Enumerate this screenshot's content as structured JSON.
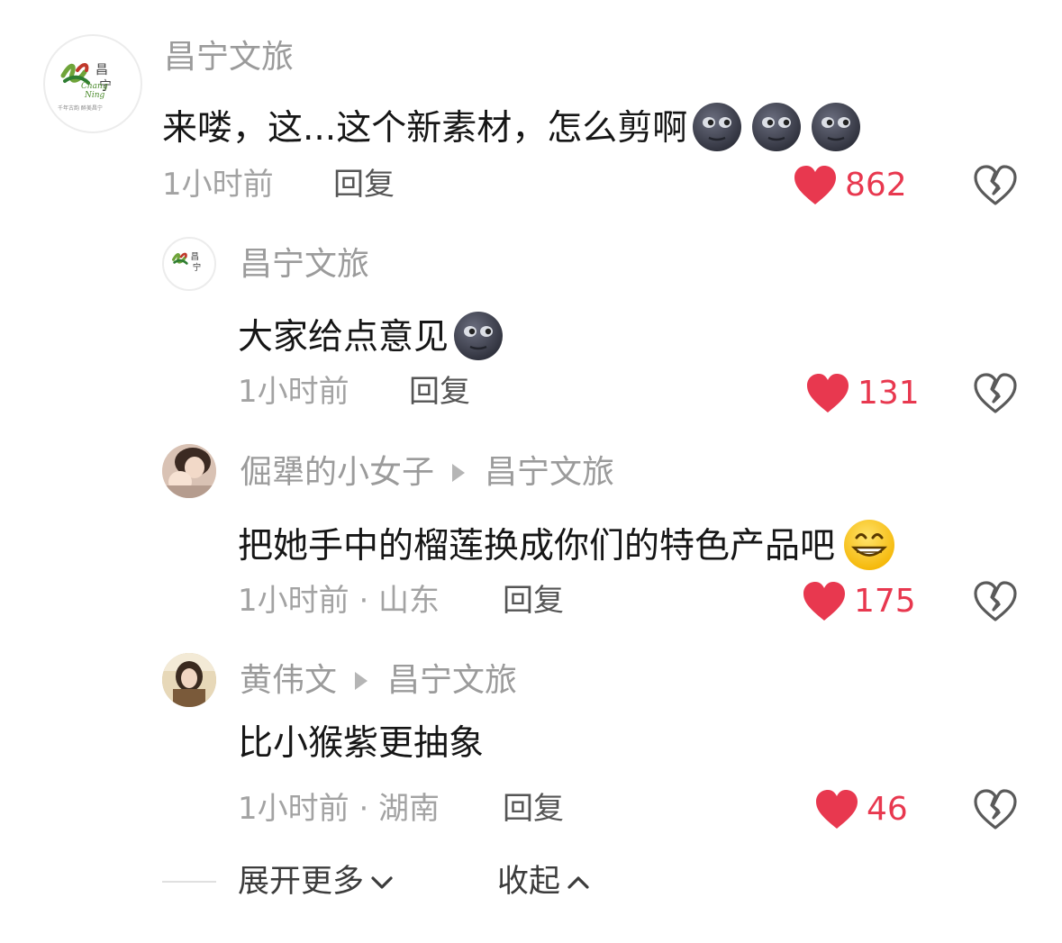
{
  "comments": [
    {
      "author": "昌宁文旅",
      "text": "来喽，这...这个新素材，怎么剪啊",
      "emojis": [
        "new-moon-face-emoji",
        "new-moon-face-emoji",
        "new-moon-face-emoji"
      ],
      "time": "1小时前",
      "reply_label": "回复",
      "likes": "862"
    },
    {
      "author": "昌宁文旅",
      "text": "大家给点意见",
      "emojis": [
        "new-moon-face-emoji"
      ],
      "time": "1小时前",
      "reply_label": "回复",
      "likes": "131"
    },
    {
      "author": "倔犟的小女子",
      "reply_to": "昌宁文旅",
      "text": "把她手中的榴莲换成你们的特色产品吧",
      "emojis": [
        "grinning-face-emoji"
      ],
      "time": "1小时前 · 山东",
      "reply_label": "回复",
      "likes": "175"
    },
    {
      "author": "黄伟文",
      "reply_to": "昌宁文旅",
      "text": "比小猴紫更抽象",
      "time": "1小时前 · 湖南",
      "reply_label": "回复",
      "likes": "46"
    }
  ],
  "logo": {
    "line1": "Chang",
    "line2": "Ning",
    "char1": "昌",
    "char2": "宁",
    "tagline": "千年古韵 醉美昌宁"
  },
  "footer": {
    "expand_label": "展开更多",
    "collapse_label": "收起"
  },
  "colors": {
    "like_red": "#e8384f",
    "name_gray": "#9b9b9b",
    "text_black": "#161616"
  }
}
